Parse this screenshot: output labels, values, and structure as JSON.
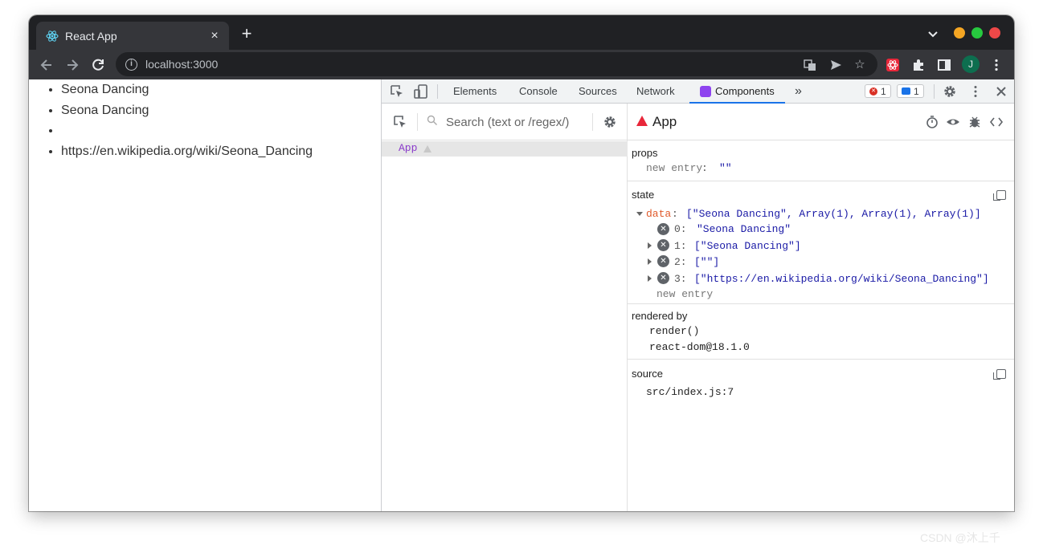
{
  "browser": {
    "tab_title": "React App",
    "tab_close": "×",
    "new_tab": "+",
    "url": "localhost:3000",
    "profile_initial": "J",
    "colors": {
      "chrome_dark": "#202124",
      "chrome_mid": "#35363a",
      "close": "#ee4848",
      "minimize": "#f5a623",
      "maximize": "#27c93f"
    }
  },
  "page": {
    "items": [
      "Seona Dancing",
      "Seona Dancing",
      "",
      "https://en.wikipedia.org/wiki/Seona_Dancing"
    ]
  },
  "devtools": {
    "tabs": [
      "Elements",
      "Console",
      "Sources",
      "Network",
      "Components"
    ],
    "more_tabs": "»",
    "error_count": "1",
    "message_count": "1",
    "search_placeholder": "Search (text or /regex/)",
    "tree_root": "App",
    "selected_component": "App",
    "props": {
      "label": "props",
      "new_entry_key": "new entry",
      "new_entry_value": "\"\""
    },
    "state": {
      "label": "state",
      "data_key": "data",
      "data_summary": "[\"Seona Dancing\", Array(1), Array(1), Array(1)]",
      "entries": [
        {
          "index": "0:",
          "value": "\"Seona Dancing\""
        },
        {
          "index": "1:",
          "value": "[\"Seona Dancing\"]"
        },
        {
          "index": "2:",
          "value": "[\"\"]"
        },
        {
          "index": "3:",
          "value": "[\"https://en.wikipedia.org/wiki/Seona_Dancing\"]"
        }
      ],
      "new_entry": "new entry"
    },
    "rendered_by": {
      "label": "rendered by",
      "items": [
        "render()",
        "react-dom@18.1.0"
      ]
    },
    "source": {
      "label": "source",
      "value": "src/index.js:7"
    }
  },
  "watermark": "CSDN @沐上千"
}
